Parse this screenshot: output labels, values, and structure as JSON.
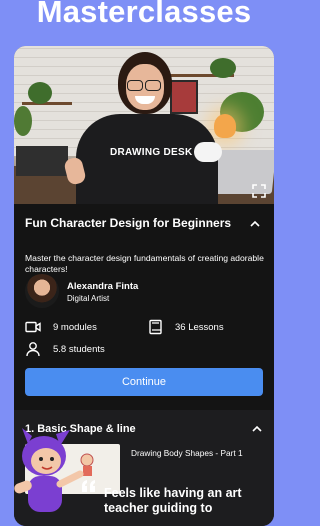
{
  "headline": "Masterclasses",
  "video": {
    "shirt_text": "DRAWING DESK"
  },
  "course": {
    "title": "Fun Character Design for Beginners",
    "description": "Master the character design fundamentals of creating adorable characters!"
  },
  "author": {
    "name": "Alexandra Finta",
    "role": "Digital Artist"
  },
  "stats": {
    "modules": "9 modules",
    "lessons": "36 Lessons",
    "students": "5.8 students"
  },
  "continue_label": "Continue",
  "section": {
    "title": "1. Basic Shape & line",
    "lesson_title": "Drawing Body Shapes - Part 1"
  },
  "tagline": "Feels like having an art teacher guiding to",
  "colors": {
    "background": "#7e8ff6",
    "card": "#141414",
    "accent": "#4a8df0",
    "mascot": "#7b3fd1"
  },
  "icons": [
    "fullscreen-icon",
    "chevron-up-icon",
    "video-icon",
    "book-icon",
    "user-icon",
    "quote-icon"
  ]
}
